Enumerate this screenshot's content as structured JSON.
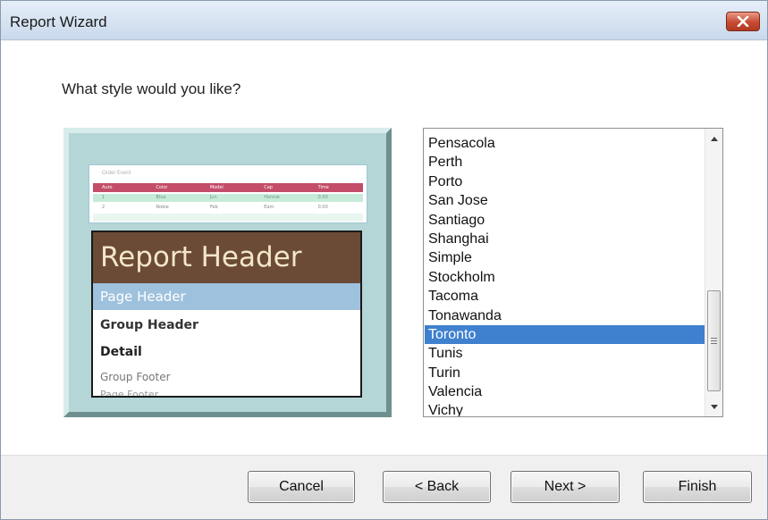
{
  "window": {
    "title": "Report Wizard"
  },
  "prompt": "What style would you like?",
  "preview": {
    "mini_table": {
      "title": "Order Event",
      "headers": [
        "Auto",
        "Color",
        "Model",
        "Cap",
        "Time"
      ],
      "rows": [
        [
          "1",
          "Blue",
          "Jun",
          "Honnie",
          "0.00"
        ],
        [
          "2",
          "Nobie",
          "Feb",
          "Eam",
          "0.00"
        ],
        [
          "",
          "",
          "",
          "",
          ""
        ]
      ]
    },
    "report_header": "Report Header",
    "page_header": "Page Header",
    "group_header": "Group Header",
    "detail": "Detail",
    "group_footer": "Group Footer",
    "page_footer": "Page Footer"
  },
  "style_list": {
    "items": [
      "Pensacola",
      "Perth",
      "Porto",
      "San Jose",
      "Santiago",
      "Shanghai",
      "Simple",
      "Stockholm",
      "Tacoma",
      "Tonawanda",
      "Toronto",
      "Tunis",
      "Turin",
      "Valencia",
      "Vichy"
    ],
    "selected": "Toronto"
  },
  "buttons": {
    "cancel": "Cancel",
    "back": "< Back",
    "next": "Next >",
    "finish": "Finish"
  },
  "colors": {
    "selection": "#3f80cf",
    "report_header_band": "#6b4a36",
    "page_header_band": "#9ec1dd",
    "preview_frame": "#b5d6d6",
    "close_button": "#c74a33"
  },
  "icons": {
    "close": "close-icon",
    "scroll_up": "chevron-up-icon",
    "scroll_down": "chevron-down-icon",
    "scroll_grip": "grip-icon"
  }
}
